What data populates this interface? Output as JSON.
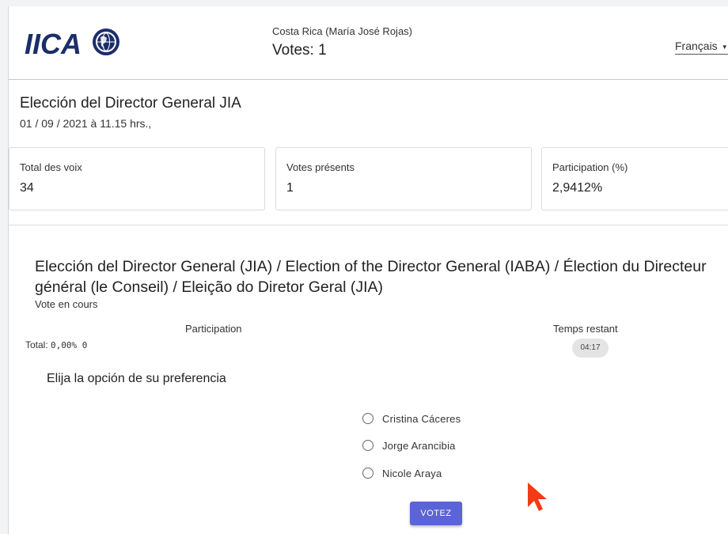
{
  "header": {
    "logo_text": "IICA",
    "delegation": "Costa Rica (María José Rojas)",
    "votes": "Votes: 1",
    "language": "Français"
  },
  "election": {
    "title": "Elección del Director General JIA",
    "date": "01 / 09 / 2021 à 11.15 hrs.,"
  },
  "stats": [
    {
      "label": "Total des voix",
      "value": "34"
    },
    {
      "label": "Votes présents",
      "value": "1"
    },
    {
      "label": "Participation (%)",
      "value": "2,9412%"
    }
  ],
  "vote": {
    "title": "Elección del Director General (JIA) / Election of the Director General (IABA) / Élection du Directeur général (le Conseil) / Eleição do Diretor Geral (JIA)",
    "status": "Vote en cours",
    "participation_label": "Participation",
    "total_label": "Total:",
    "total_value": "0,00% 0",
    "time_label": "Temps restant",
    "time_value": "04:17",
    "prompt": "Elija la opción de su preferencia",
    "options": [
      {
        "label": "Cristina Cáceres",
        "selected": false
      },
      {
        "label": "Jorge Arancibia",
        "selected": false
      },
      {
        "label": "Nicole Araya",
        "selected": false
      }
    ],
    "submit_label": "VOTEZ"
  },
  "colors": {
    "brand": "#1b2e6b",
    "button": "#5b64d6",
    "cursor": "#f23b14"
  },
  "icons": {
    "logo_globe": "globe-icon",
    "language_caret": "caret-down-icon",
    "option_radio": "radio-icon",
    "pointer": "mouse-cursor-icon"
  }
}
